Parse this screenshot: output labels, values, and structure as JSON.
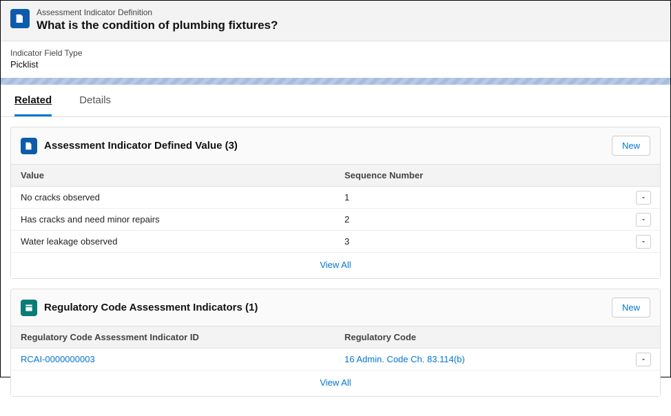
{
  "header": {
    "subtitle": "Assessment Indicator Definition",
    "title": "What is the condition of plumbing fixtures?"
  },
  "field": {
    "label": "Indicator Field Type",
    "value": "Picklist"
  },
  "tabs": {
    "related": "Related",
    "details": "Details"
  },
  "card1": {
    "title": "Assessment Indicator Defined Value (3)",
    "new_label": "New",
    "headers": {
      "value": "Value",
      "seq": "Sequence Number"
    },
    "rows": [
      {
        "value": "No cracks observed",
        "seq": "1"
      },
      {
        "value": "Has cracks and need minor repairs",
        "seq": "2"
      },
      {
        "value": "Water leakage observed",
        "seq": "3"
      }
    ],
    "view_all": "View All"
  },
  "card2": {
    "title": "Regulatory Code Assessment Indicators (1)",
    "new_label": "New",
    "headers": {
      "id": "Regulatory Code Assessment Indicator ID",
      "code": "Regulatory Code"
    },
    "rows": [
      {
        "id": "RCAI-0000000003",
        "code": "16 Admin. Code Ch. 83.114(b)"
      }
    ],
    "view_all": "View All"
  }
}
